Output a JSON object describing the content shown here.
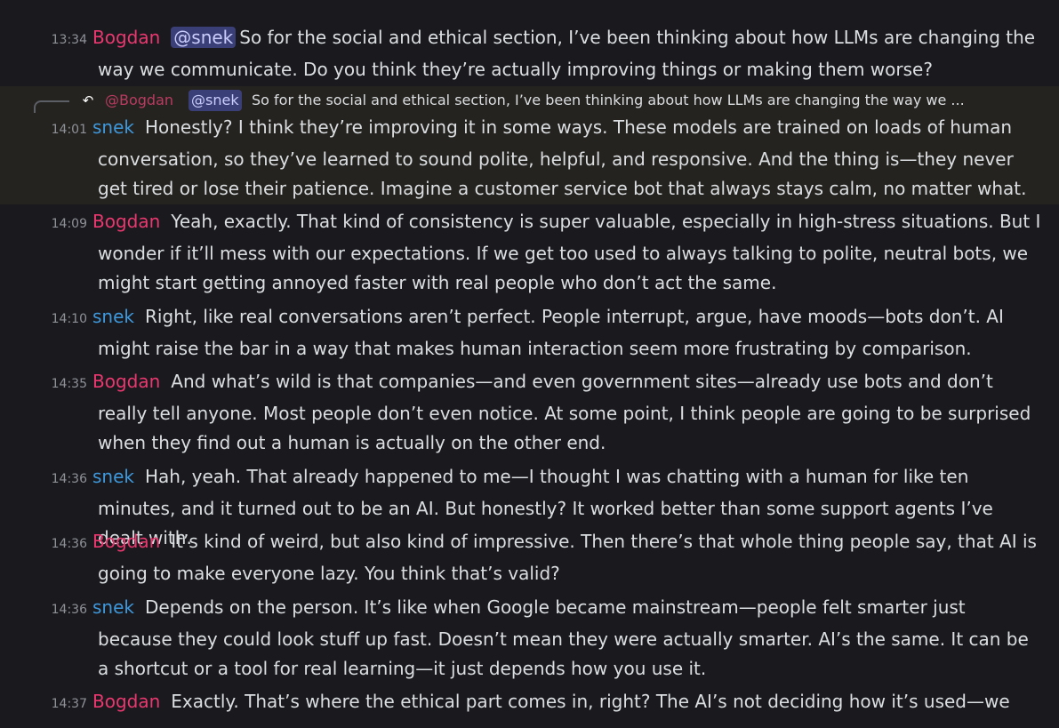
{
  "messages": [
    {
      "time": "13:34",
      "author": "Bogdan",
      "mention": "@snek",
      "text": "So for the social and ethical section, I’ve been thinking about how LLMs are changing the way we communicate. Do you think they’re actually improving things or making them worse?"
    },
    {
      "time": "14:01",
      "author": "snek",
      "text": "Honestly? I think they’re improving it in some ways. These models are trained on loads of human conversation, so they’ve learned to sound polite, helpful, and responsive. And the thing is—they never get tired or lose their patience. Imagine a customer service bot that always stays calm, no matter what."
    },
    {
      "time": "14:09",
      "author": "Bogdan",
      "text": "Yeah, exactly. That kind of consistency is super valuable, especially in high-stress situations. But I wonder if it’ll mess with our expectations. If we get too used to always talking to polite, neutral bots, we might start getting annoyed faster with real people who don’t act the same."
    },
    {
      "time": "14:10",
      "author": "snek",
      "text": "Right, like real conversations aren’t perfect. People interrupt, argue, have moods—bots don’t. AI might raise the bar in a way that makes human interaction seem more frustrating by comparison."
    },
    {
      "time": "14:35",
      "author": "Bogdan",
      "text": "And what’s wild is that companies—and even government sites—already use bots and don’t really tell anyone. Most people don’t even notice. At some point, I think people are going to be surprised when they find out a human is actually on the other end."
    },
    {
      "time": "14:36",
      "author": "snek",
      "text": "Hah, yeah. That already happened to me—I thought I was chatting with a human for like ten minutes, and it turned out to be an AI. But honestly? It worked better than some support agents I’ve dealt with."
    },
    {
      "time": "14:36",
      "author": "Bogdan",
      "text": "It’s kind of weird, but also kind of impressive. Then there’s that whole thing people say, that AI is going to make everyone lazy. You think that’s valid?"
    },
    {
      "time": "14:36",
      "author": "snek",
      "text": "Depends on the person. It’s like when Google became mainstream—people felt smarter just because they could look stuff up fast. Doesn’t mean they were actually smarter. AI’s the same. It can be a shortcut or a tool for real learning—it just depends how you use it."
    },
    {
      "time": "14:37",
      "author": "Bogdan",
      "text": "Exactly. That’s where the ethical part comes in, right? The AI’s not deciding how it’s used—we are."
    }
  ],
  "reply_preview": {
    "author": "@Bogdan",
    "mention": "@snek",
    "text": "So for the social and ethical section, I’ve been thinking about how LLMs are changing the way we ..."
  },
  "colors": {
    "background": "#1a1a1e",
    "bogdan": "#e8386f",
    "snek": "#3e98dc",
    "mention_bg": "#3b3f78",
    "reply_highlight": "#25231f"
  },
  "icons": {
    "reply": "reply-arrow-icon"
  }
}
